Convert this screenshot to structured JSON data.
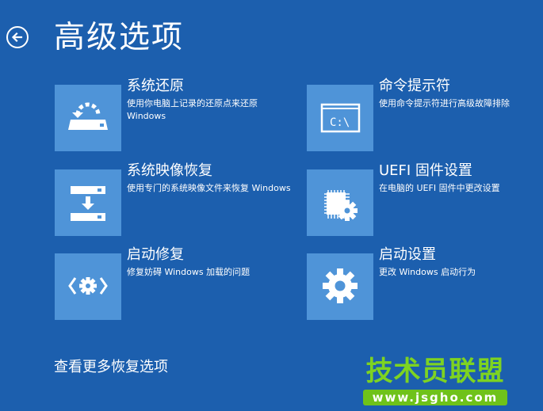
{
  "page": {
    "title": "高级选项"
  },
  "options": [
    {
      "title": "系统还原",
      "desc": "使用你电脑上记录的还原点来还原 Windows",
      "icon": "system-restore-icon"
    },
    {
      "title": "命令提示符",
      "desc": "使用命令提示符进行高级故障排除",
      "icon": "command-prompt-icon",
      "icon_text": "C:\\"
    },
    {
      "title": "系统映像恢复",
      "desc": "使用专门的系统映像文件来恢复 Windows",
      "icon": "system-image-recovery-icon"
    },
    {
      "title": "UEFI 固件设置",
      "desc": "在电脑的 UEFI 固件中更改设置",
      "icon": "uefi-firmware-icon"
    },
    {
      "title": "启动修复",
      "desc": "修复妨碍 Windows 加载的问题",
      "icon": "startup-repair-icon"
    },
    {
      "title": "启动设置",
      "desc": "更改 Windows 启动行为",
      "icon": "startup-settings-icon"
    }
  ],
  "more_options_label": "查看更多恢复选项",
  "watermark": {
    "text": "技术员联盟",
    "url": "www.jsgho.com"
  },
  "colors": {
    "background": "#1c5fae",
    "tile": "#4f94d8",
    "watermark": "#7ed321"
  }
}
